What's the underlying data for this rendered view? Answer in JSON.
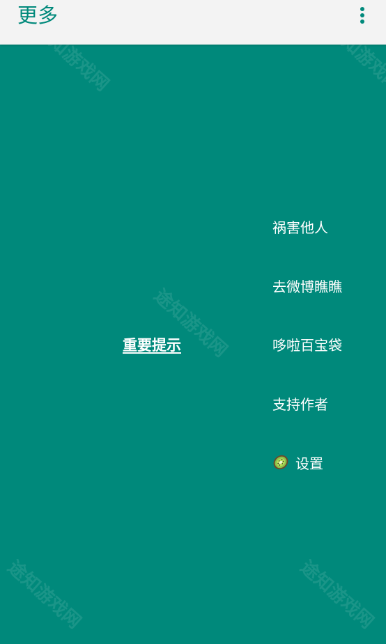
{
  "appbar": {
    "title": "更多",
    "overflow_icon": "more-vert-icon"
  },
  "main": {
    "notice_link": "重要提示",
    "menu_items": [
      {
        "label": "祸害他人"
      },
      {
        "label": "去微博瞧瞧"
      },
      {
        "label": "哆啦百宝袋"
      },
      {
        "label": "支持作者"
      },
      {
        "label": "设置",
        "icon": "kiwi-icon"
      }
    ]
  },
  "watermark_text": "途知游戏网",
  "colors": {
    "primary": "#00897b",
    "appbar_bg": "#f3f3f3",
    "text_on_primary": "#ffffff"
  }
}
